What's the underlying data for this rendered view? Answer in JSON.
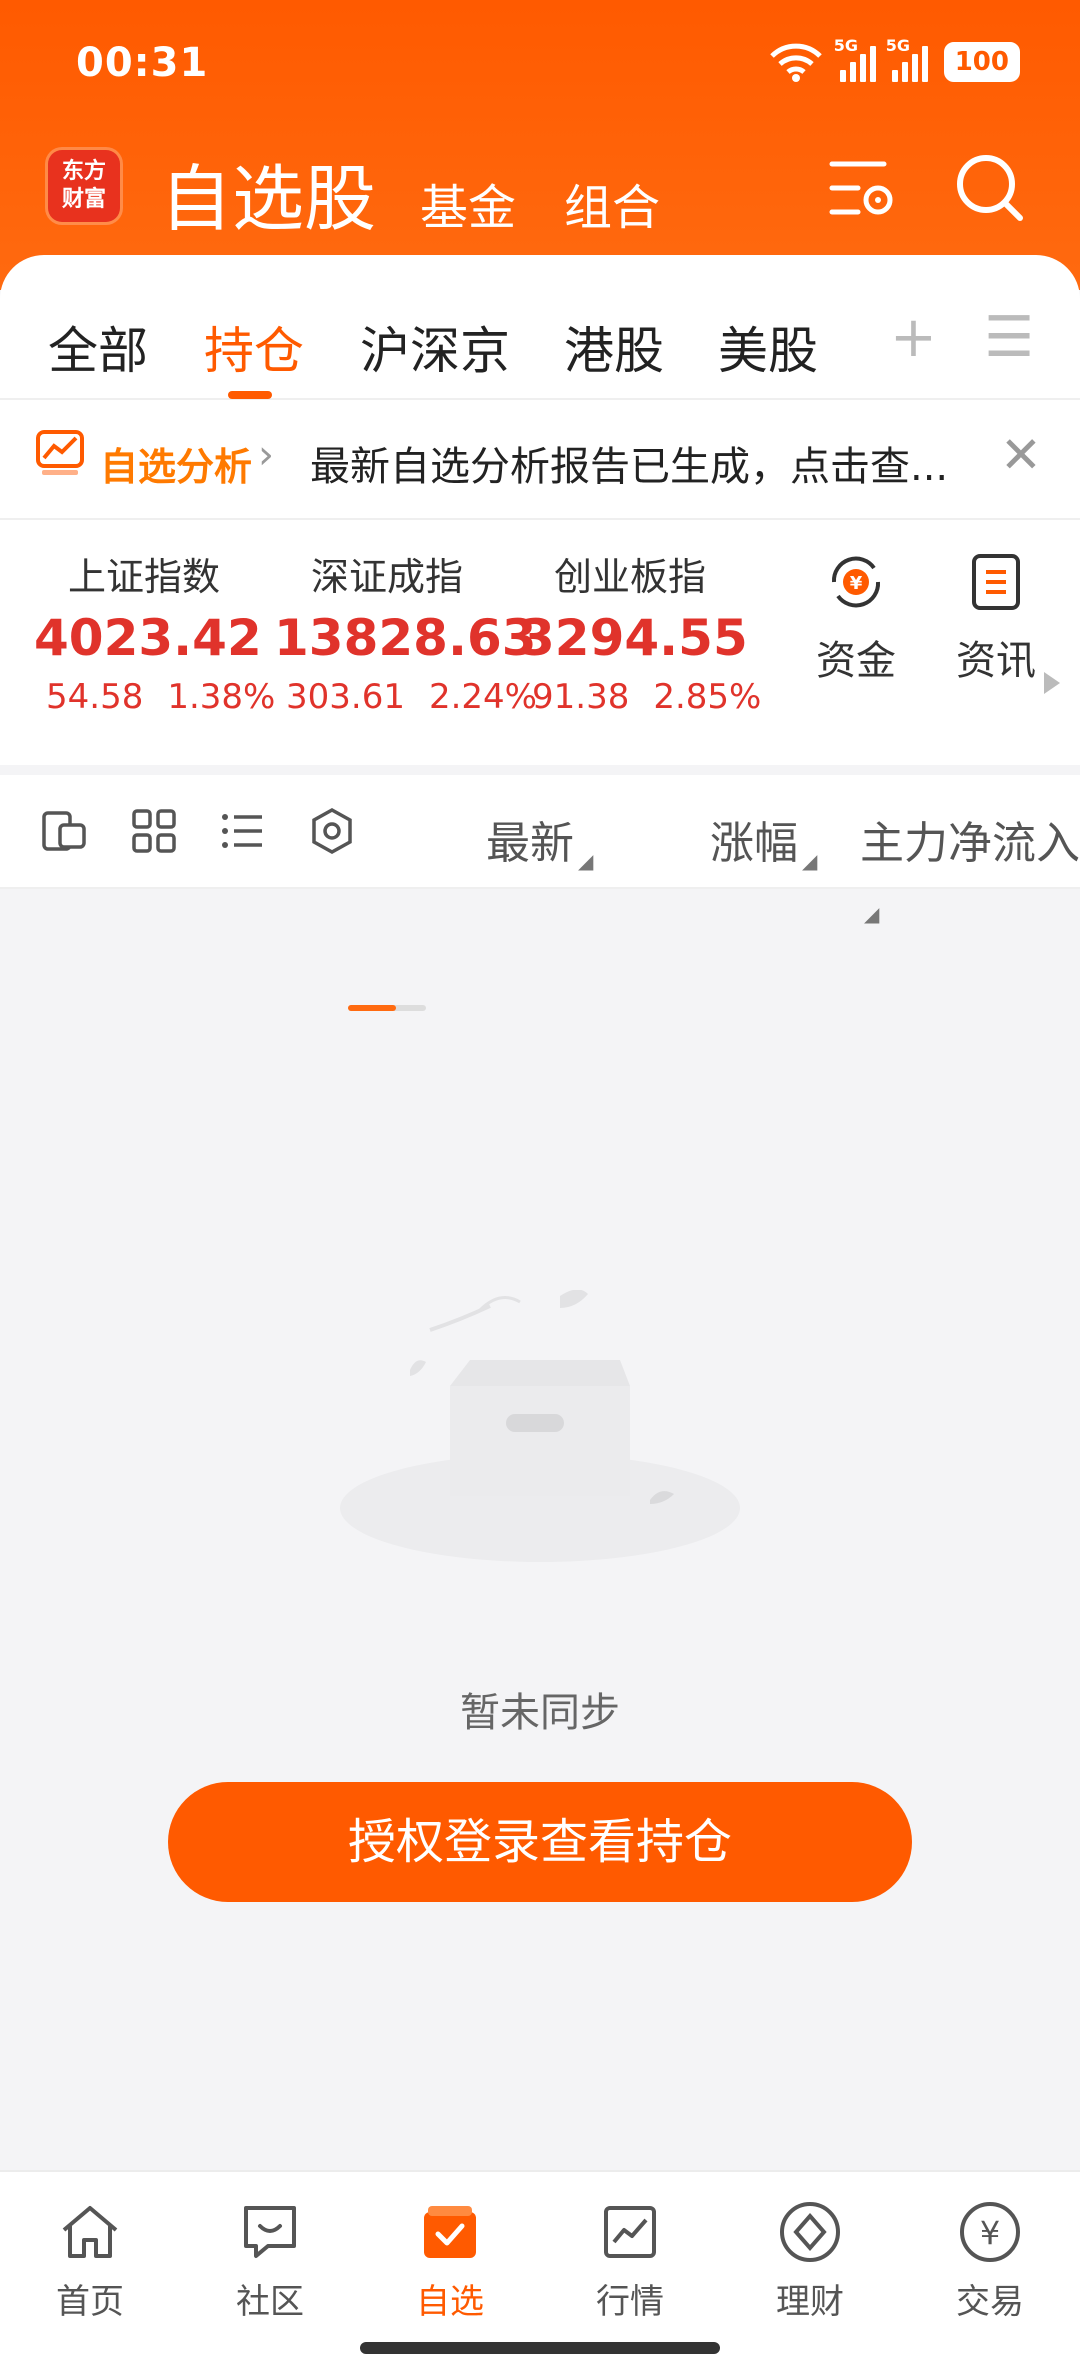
{
  "status": {
    "time": "00:31",
    "battery": "100",
    "net1": "5G",
    "net2": "5G"
  },
  "header": {
    "logo_line1": "东方",
    "logo_line2": "财富",
    "title": "自选股",
    "tab_fund": "基金",
    "tab_combo": "组合"
  },
  "tabs": {
    "all": "全部",
    "holdings": "持仓",
    "hsj": "沪深京",
    "hk": "港股",
    "us": "美股",
    "plus": "+",
    "menu": "☰"
  },
  "banner": {
    "tag": "自选分析",
    "arrow": "›",
    "text": "最新自选分析报告已生成，点击查...",
    "close": "✕"
  },
  "indices": [
    {
      "name": "上证指数",
      "value": "4023.42",
      "change": "54.58",
      "pct": "1.38%"
    },
    {
      "name": "深证成指",
      "value": "13828.63",
      "change": "303.61",
      "pct": "2.24%"
    },
    {
      "name": "创业板指",
      "value": "3294.55",
      "change": "91.38",
      "pct": "2.85%"
    }
  ],
  "quick": {
    "funds": "资金",
    "news": "资讯"
  },
  "sortbar": {
    "latest": "最新",
    "change": "涨幅",
    "inflow": "主力净流入"
  },
  "empty": {
    "text": "暂未同步",
    "button": "授权登录查看持仓"
  },
  "nav": {
    "home": "首页",
    "community": "社区",
    "watchlist": "自选",
    "market": "行情",
    "wealth": "理财",
    "trade": "交易"
  },
  "colors": {
    "brand": "#ff5a00",
    "up": "#e0332b"
  }
}
